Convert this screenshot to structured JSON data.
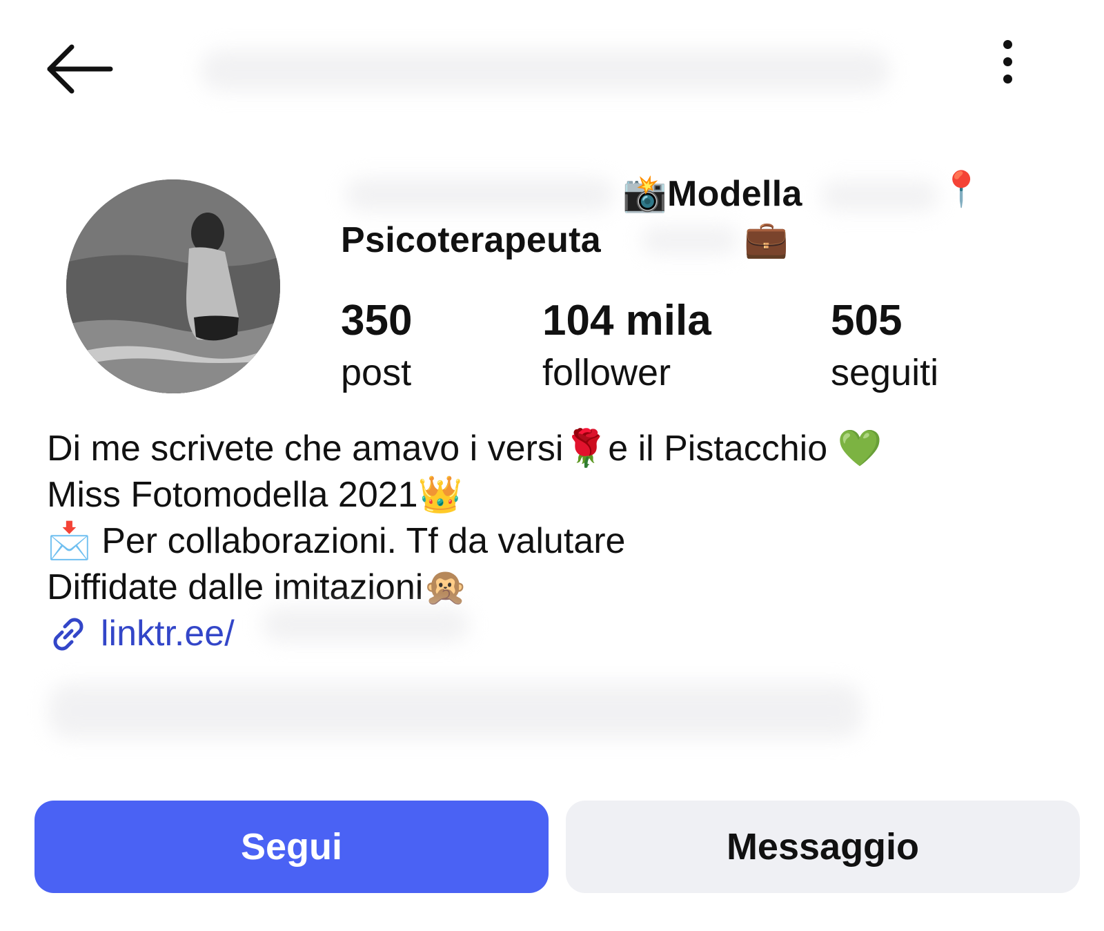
{
  "header": {
    "back_icon": "arrow-left-icon",
    "more_icon": "more-vertical-icon"
  },
  "profile": {
    "title_emoji": "📸",
    "title": "Modella",
    "pin_emoji": "📍",
    "subtitle": "Psicoterapeuta",
    "briefcase_emoji": "💼"
  },
  "stats": [
    {
      "value": "350",
      "label": "post"
    },
    {
      "value": "104 mila",
      "label": "follower"
    },
    {
      "value": "505",
      "label": "seguiti"
    }
  ],
  "bio": {
    "line1_a": "Di me scrivete che amavo i versi",
    "line1_rose": "🌹",
    "line1_b": "e il Pistacchio",
    "line1_heart": "💚",
    "line2": "Miss Fotomodella 2021",
    "line2_crown": "👑",
    "line3_envelope": "📩",
    "line3": "Per collaborazioni. Tf da valutare",
    "line4": "Diffidate dalle imitazioni",
    "line4_monkey": "🙊",
    "link": "linktr.ee/"
  },
  "actions": {
    "follow_label": "Segui",
    "message_label": "Messaggio"
  },
  "colors": {
    "accent": "#4a62f4",
    "link": "#3346c8",
    "secondary_button": "#eff0f4"
  }
}
